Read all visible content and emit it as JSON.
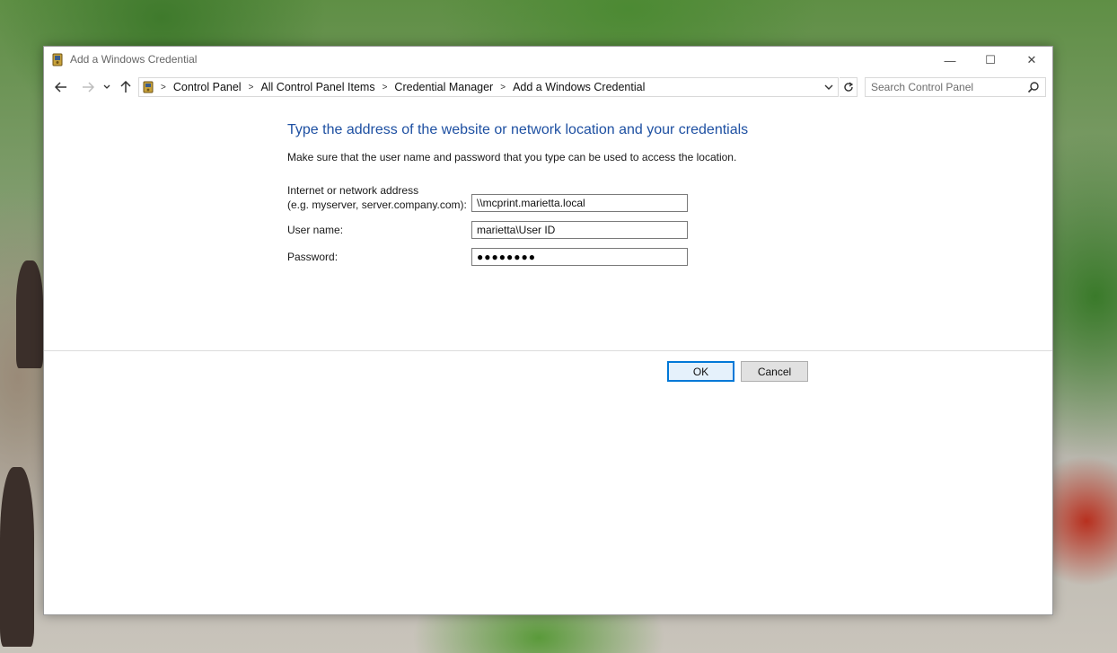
{
  "window": {
    "title": "Add a Windows Credential",
    "controls": {
      "minimize": "—",
      "maximize": "☐",
      "close": "✕"
    }
  },
  "nav": {
    "back_icon": "back-arrow-icon",
    "forward_icon": "forward-arrow-icon",
    "recent_icon": "chevron-down-icon",
    "up_icon": "up-arrow-icon"
  },
  "address": {
    "breadcrumbs": [
      "Control Panel",
      "All Control Panel Items",
      "Credential Manager",
      "Add a Windows Credential"
    ],
    "separator": ">"
  },
  "search": {
    "placeholder": "Search Control Panel"
  },
  "form": {
    "heading": "Type the address of the website or network location and your credentials",
    "subtext": "Make sure that the user name and password that you type can be used to access the location.",
    "address_label_line1": "Internet or network address",
    "address_label_line2": "(e.g. myserver, server.company.com):",
    "address_value": "\\\\mcprint.marietta.local",
    "username_label": "User name:",
    "username_value": "marietta\\User ID",
    "password_label": "Password:",
    "password_mask": "●●●●●●●●"
  },
  "buttons": {
    "ok": "OK",
    "cancel": "Cancel"
  },
  "colors": {
    "heading": "#1e50a2",
    "ok_border": "#0078d7"
  }
}
